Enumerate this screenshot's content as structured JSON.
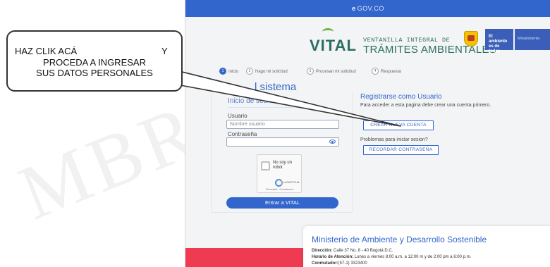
{
  "watermark": "MBRE",
  "gov_bar": {
    "mark": "e",
    "label": "GOV.CO"
  },
  "logo": {
    "brand": "VITAL",
    "line1": "VENTANILLA INTEGRAL DE",
    "line2": "TRÁMITES AMBIENTALES"
  },
  "ministry_badge": {
    "tag": "El ambiente es de todos",
    "name": "Minambiente"
  },
  "steps": [
    {
      "num": "1",
      "label": "Inicio"
    },
    {
      "num": "2",
      "label": "Hago mi solicitud"
    },
    {
      "num": "3",
      "label": "Procesan mi solicitud"
    },
    {
      "num": "4",
      "label": "Respuesta"
    }
  ],
  "section_title": "l sistema",
  "login": {
    "title": "Inicio de sesión",
    "user_label": "Usuario",
    "user_placeholder": "Nombre usuario",
    "password_label": "Contraseña",
    "captcha_text": "No soy un robot",
    "captcha_brand": "reCAPTCHA",
    "captcha_legal": "Privacidad - Condiciones",
    "submit": "Entrar a VITAL"
  },
  "register": {
    "title": "Registrarse como Usuario",
    "text": "Para acceder a esta pagina debe crear una cuenta primero.",
    "create_button": "CREAR NUEVA CUENTA",
    "problems": "Problemas para iniciar sesion?",
    "recover_button": "RECORDAR CONTRASEÑA"
  },
  "ministry_card": {
    "title": "Ministerio de Ambiente y Desarrollo Sostenible",
    "address_label": "Dirección:",
    "address": "Calle 37 No. 8 - 40 Bogotá D.C.",
    "hours_label": "Horario de Atención:",
    "hours": "Lunes a viernes 8:00 a.m. a 12:00 m y de 2:00 pm a 6:00 p.m.",
    "phone_label": "Conmutador:",
    "phone": "(57-1) 3323400"
  },
  "callout": {
    "line1": "HAZ CLIK ACÁ",
    "line1_end": "Y",
    "line2": "PROCEDA A INGRESAR",
    "line3": "SUS DATOS PERSONALES"
  },
  "colors": {
    "primary": "#3366cc",
    "brand_green": "#2c6e63",
    "footer_red": "#ef3b52"
  }
}
